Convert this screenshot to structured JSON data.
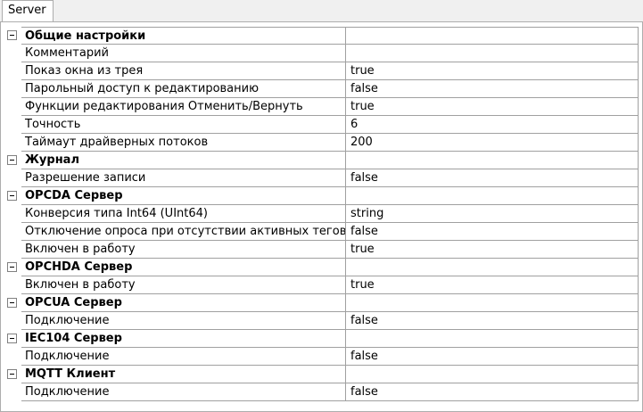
{
  "tab": {
    "label": "Server"
  },
  "groups": [
    {
      "title": "Общие настройки",
      "items": [
        {
          "label": "Комментарий",
          "value": ""
        },
        {
          "label": "Показ окна из трея",
          "value": "true"
        },
        {
          "label": "Парольный доступ к редактированию",
          "value": "false"
        },
        {
          "label": "Функции редактирования Отменить/Вернуть",
          "value": "true"
        },
        {
          "label": "Точность",
          "value": "6"
        },
        {
          "label": "Таймаут драйверных потоков",
          "value": "200"
        }
      ]
    },
    {
      "title": "Журнал",
      "items": [
        {
          "label": "Разрешение записи",
          "value": "false"
        }
      ]
    },
    {
      "title": "OPCDA Сервер",
      "items": [
        {
          "label": "Конверсия типа Int64 (UInt64)",
          "value": "string"
        },
        {
          "label": "Отключение опроса при отсутствии активных тегов",
          "value": "false"
        },
        {
          "label": "Включен в работу",
          "value": "true"
        }
      ]
    },
    {
      "title": "OPCHDA  Сервер",
      "items": [
        {
          "label": "Включен в работу",
          "value": "true"
        }
      ]
    },
    {
      "title": "OPCUA Сервер",
      "items": [
        {
          "label": "Подключение",
          "value": "false"
        }
      ]
    },
    {
      "title": "IEC104 Сервер",
      "items": [
        {
          "label": "Подключение",
          "value": "false"
        }
      ]
    },
    {
      "title": "MQTT Клиент",
      "items": [
        {
          "label": "Подключение",
          "value": "false"
        }
      ]
    }
  ]
}
